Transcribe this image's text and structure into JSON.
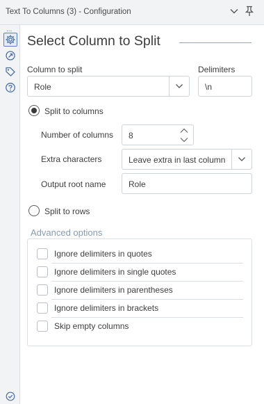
{
  "window": {
    "title": "Text To Columns (3) - Configuration"
  },
  "sidebar": {
    "dots": "...",
    "icons": [
      "gear-icon",
      "connection-icon",
      "tag-icon",
      "help-icon"
    ]
  },
  "page": {
    "heading": "Select Column to Split"
  },
  "column_to_split": {
    "label": "Column to split",
    "value": "Role"
  },
  "delimiters": {
    "label": "Delimiters",
    "value": "\\n"
  },
  "split_to_columns": {
    "label": "Split to columns",
    "selected": true,
    "number_of_columns": {
      "label": "Number of columns",
      "value": "8"
    },
    "extra_characters": {
      "label": "Extra characters",
      "value": "Leave extra in last column"
    },
    "output_root_name": {
      "label": "Output root name",
      "value": "Role"
    }
  },
  "split_to_rows": {
    "label": "Split to rows",
    "selected": false
  },
  "advanced": {
    "title": "Advanced options",
    "options": [
      {
        "label": "Ignore delimiters in quotes",
        "checked": false
      },
      {
        "label": "Ignore delimiters in single quotes",
        "checked": false
      },
      {
        "label": "Ignore delimiters in parentheses",
        "checked": false
      },
      {
        "label": "Ignore delimiters in brackets",
        "checked": false
      },
      {
        "label": "Skip empty columns",
        "checked": false
      }
    ]
  },
  "colors": {
    "accent": "#5b7fbf",
    "advanced_title": "#8a9bb0",
    "border": "#cfd4d9"
  }
}
